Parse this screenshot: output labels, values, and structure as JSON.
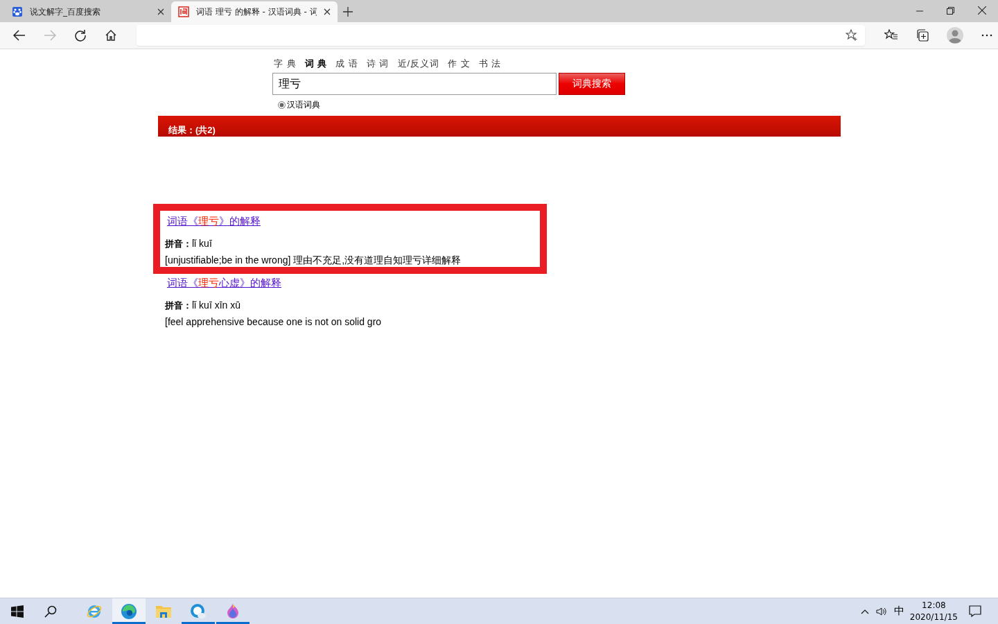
{
  "browser": {
    "tabs": [
      {
        "title": "说文解字_百度搜索",
        "kind": "paw",
        "selected": false
      },
      {
        "title": "词语 理亏 的解释 - 汉语词典 - 词",
        "kind": "ci",
        "selected": true
      }
    ]
  },
  "page": {
    "nav": [
      {
        "label": "字 典",
        "selected": false
      },
      {
        "label": "词 典",
        "selected": true
      },
      {
        "label": "成 语",
        "selected": false
      },
      {
        "label": "诗 词",
        "selected": false
      },
      {
        "label": "近/反义词",
        "selected": false
      },
      {
        "label": "作 文",
        "selected": false
      },
      {
        "label": "书 法",
        "selected": false
      }
    ],
    "search": {
      "value": "理亏",
      "button": "词典搜索",
      "radio": {
        "label": "汉语词典",
        "selected": true
      }
    },
    "results_bar": "结果：(共2)",
    "results": [
      {
        "title_parts": [
          {
            "text": "词语《",
            "match": false
          },
          {
            "text": "理亏",
            "match": true
          },
          {
            "text": "》的解释",
            "match": false
          }
        ],
        "pinyin_label": "拼音：",
        "pinyin": "lǐ kuī",
        "definition": "[unjustifiable;be in the wrong] 理由不充足,没有道理自知理亏详细解释",
        "outlined": true
      },
      {
        "title_parts": [
          {
            "text": "词语《",
            "match": false
          },
          {
            "text": "理亏",
            "match": true
          },
          {
            "text": "心虚》的解释",
            "match": false
          }
        ],
        "pinyin_label": "拼音：",
        "pinyin": "lǐ kuī xīn xū",
        "definition": "[feel apprehensive because one is not on solid gro",
        "outlined": false
      }
    ]
  },
  "taskbar": {
    "apps": [
      {
        "kind": "ie",
        "running": false,
        "active": false
      },
      {
        "kind": "edge",
        "running": true,
        "active": true
      },
      {
        "kind": "folder",
        "running": false,
        "active": false
      },
      {
        "kind": "search-app",
        "running": true,
        "active": false
      },
      {
        "kind": "flame",
        "running": true,
        "active": false
      }
    ],
    "ime": "中",
    "time": "12:08",
    "date": "2020/11/15"
  }
}
